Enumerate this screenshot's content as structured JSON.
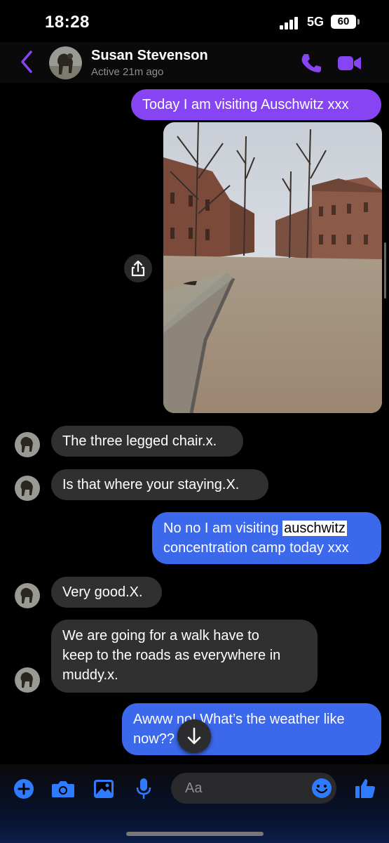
{
  "status_bar": {
    "time": "18:28",
    "network": "5G",
    "battery": "60"
  },
  "header": {
    "contact_name": "Susan Stevenson",
    "contact_status": "Active 21m ago"
  },
  "messages": {
    "m1": "Today I am visiting Auschwitz xxx",
    "m2": "The three legged chair.x.",
    "m3": "Is that where your staying.X.",
    "m4_line1_pre": "No no I am visiting ",
    "m4_highlight": "auschwitz",
    "m4_line2": "concentration camp today xxx",
    "m5": "Very good.X.",
    "m6_line1": "We are going for a walk have to",
    "m6_line2": "keep to the roads as everywhere in",
    "m6_line3": "muddy.x.",
    "m7_line1": "Awww no! What’s the weather like",
    "m7_line2": "now??"
  },
  "composer": {
    "placeholder": "Aa"
  },
  "colors": {
    "accent": "#8744f2",
    "outgoing_blue": "#3c68ec",
    "incoming": "#303030",
    "icon_blue": "#2f7bff"
  }
}
